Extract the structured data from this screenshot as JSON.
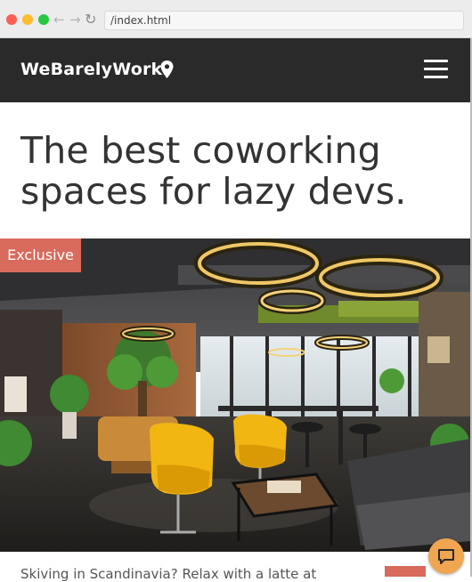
{
  "browser": {
    "url": "/index.html",
    "icons": [
      "close-dot",
      "minimize-dot",
      "maximize-dot",
      "back-arrow-icon",
      "forward-arrow-icon",
      "reload-icon"
    ]
  },
  "header": {
    "brand": "WeBarelyWork",
    "icons": [
      "location-pin-icon",
      "hamburger-menu-icon"
    ],
    "background": "#2a2a2a"
  },
  "hero": {
    "title": "The best coworking spaces for lazy devs."
  },
  "card": {
    "badge": "Exclusive",
    "badge_color": "#d86b5c",
    "caption": "Skiving in Scandinavia? Relax with a latte at"
  },
  "chat": {
    "icon": "chat-bubble-icon",
    "color": "#f0a551"
  }
}
